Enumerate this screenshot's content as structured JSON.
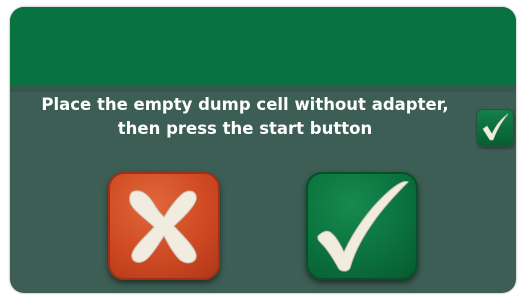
{
  "dialog": {
    "message_line1": "Place the empty dump cell without adapter,",
    "message_line2": "then press the start button",
    "checkbox_icon": "checkmark-icon",
    "cancel_icon": "x-icon",
    "confirm_icon": "checkmark-icon"
  },
  "colors": {
    "title_bar": "#087241",
    "body": "#3d5e54",
    "cancel_button": "#cf4a22",
    "confirm_button": "#0b723e",
    "icon_fill": "#f2ece0"
  }
}
